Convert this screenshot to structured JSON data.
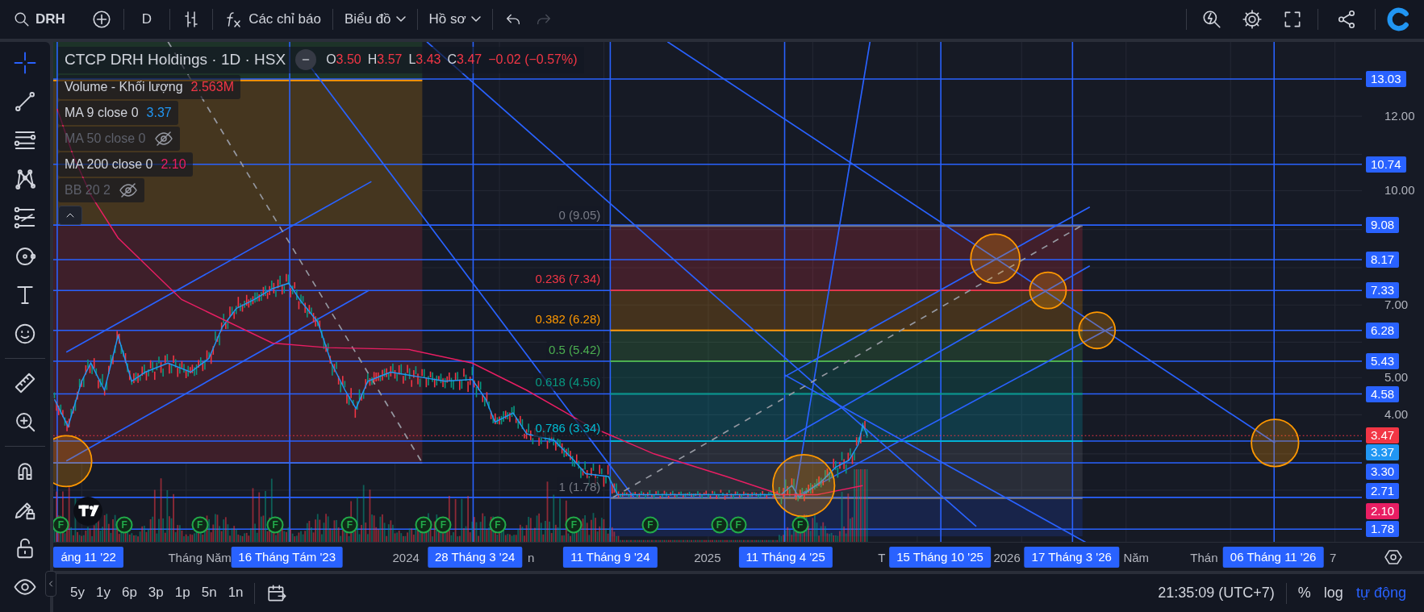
{
  "toolbar": {
    "symbol": "DRH",
    "interval": "D",
    "indicators_label": "Các chỉ báo",
    "chart_menu": "Biểu đồ",
    "profile_menu": "Hồ sơ",
    "undo_disabled": false,
    "redo_disabled": true
  },
  "tool_groups": [
    {
      "tools": [
        {
          "kind": "crosshair",
          "selected": true
        },
        {
          "kind": "trend",
          "selected": false
        },
        {
          "kind": "hlines",
          "selected": false
        },
        {
          "kind": "pattern",
          "selected": false
        },
        {
          "kind": "fib",
          "selected": false
        },
        {
          "kind": "circle",
          "selected": false
        },
        {
          "kind": "text",
          "selected": false
        },
        {
          "kind": "smiley",
          "selected": false
        }
      ]
    },
    {
      "tools": [
        {
          "kind": "ruler",
          "selected": false
        },
        {
          "kind": "zoom",
          "selected": false
        }
      ]
    },
    {
      "tools": [
        {
          "kind": "magnet",
          "selected": false
        },
        {
          "kind": "pencil_lock",
          "selected": false
        },
        {
          "kind": "lock",
          "selected": false
        },
        {
          "kind": "eye",
          "selected": false
        }
      ]
    }
  ],
  "legend": {
    "title": "CTCP DRH Holdings · 1D · HSX",
    "ohlc": [
      {
        "label": "O",
        "value": "3.50"
      },
      {
        "label": "H",
        "value": "3.57"
      },
      {
        "label": "L",
        "value": "3.43"
      },
      {
        "label": "C",
        "value": "3.47"
      }
    ],
    "change": "−0.02 (−0.57%)",
    "indicators": [
      {
        "name": "Volume - Khối lượng",
        "value": "2.563M",
        "color": "#f23645",
        "visible": true
      },
      {
        "name": "MA 9 close 0",
        "value": "3.37",
        "color": "#2196f3",
        "visible": true
      },
      {
        "name": "MA 50 close 0",
        "visible": false
      },
      {
        "name": "MA 200 close 0",
        "value": "2.10",
        "color": "#e91e63",
        "visible": true
      },
      {
        "name": "BB 20 2",
        "visible": false
      }
    ]
  },
  "fib_levels": [
    {
      "label": "0 (9.05)",
      "color": "#787b86"
    },
    {
      "label": "0.236 (7.34)",
      "color": "#f23645"
    },
    {
      "label": "0.382 (6.28)",
      "color": "#ff9800"
    },
    {
      "label": "0.5 (5.42)",
      "color": "#4caf50"
    },
    {
      "label": "0.618 (4.56)",
      "color": "#089981"
    },
    {
      "label": "0.786 (3.34)",
      "color": "#00bcd4"
    },
    {
      "label": "1 (1.78)",
      "color": "#787b86"
    }
  ],
  "event_markers": [
    {
      "label": "F"
    },
    {
      "label": "F"
    },
    {
      "label": "F"
    },
    {
      "label": "F"
    },
    {
      "label": "F"
    },
    {
      "label": "F"
    },
    {
      "label": "F"
    },
    {
      "label": "F"
    },
    {
      "label": "F"
    },
    {
      "label": "F"
    },
    {
      "label": "F"
    },
    {
      "label": "F"
    },
    {
      "label": "F"
    }
  ],
  "price_axis": {
    "ticks": [
      "12.00",
      "10.00",
      "7.00",
      "5.00",
      "4.00"
    ],
    "tags": [
      {
        "label": "13.03",
        "color": "#2962ff"
      },
      {
        "label": "10.74",
        "color": "#2962ff"
      },
      {
        "label": "9.08",
        "color": "#2962ff"
      },
      {
        "label": "8.17",
        "color": "#2962ff"
      },
      {
        "label": "7.33",
        "color": "#2962ff"
      },
      {
        "label": "6.28",
        "color": "#2962ff"
      },
      {
        "label": "5.43",
        "color": "#2962ff"
      },
      {
        "label": "4.58",
        "color": "#2962ff"
      },
      {
        "label": "3.47",
        "color": "#f23645"
      },
      {
        "label": "3.37",
        "color": "#2196f3"
      },
      {
        "label": "3.30",
        "color": "#2962ff"
      },
      {
        "label": "2.71",
        "color": "#2962ff"
      },
      {
        "label": "2.10",
        "color": "#e91e63"
      },
      {
        "label": "1.78",
        "color": "#2962ff"
      }
    ]
  },
  "time_axis": {
    "ticks": [
      "Tháng Năm",
      "2024",
      "n",
      "2025",
      "T",
      "2026",
      "Năm",
      "Thán",
      "7"
    ],
    "tags": [
      "áng 11 '22",
      "16 Tháng Tám '23",
      "28 Tháng 3 '24",
      "11 Tháng 9 '24",
      "11 Tháng 4 '25",
      "15 Tháng 10 '25",
      "17 Tháng 3 '26",
      "06 Tháng 11 '26"
    ]
  },
  "bottom_bar": {
    "ranges": [
      "5y",
      "1y",
      "6p",
      "3p",
      "1p",
      "5n",
      "1n"
    ],
    "time": "21:35:09 (UTC+7)",
    "scale_modes": [
      {
        "label": "%",
        "selected": false
      },
      {
        "label": "log",
        "selected": false
      },
      {
        "label": "tự động",
        "selected": true
      }
    ]
  }
}
